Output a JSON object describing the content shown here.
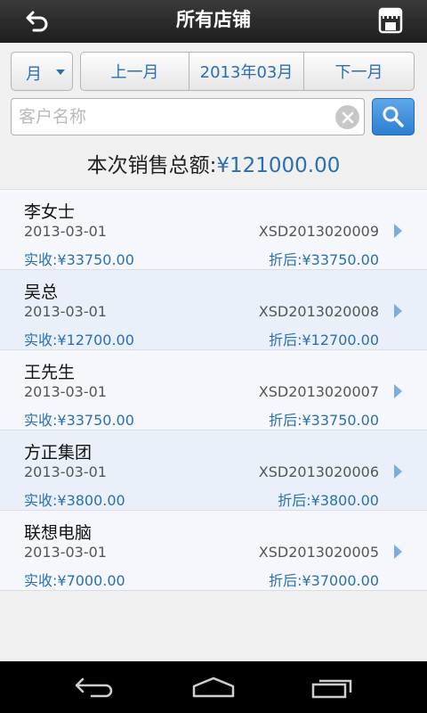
{
  "header": {
    "title": "所有店铺",
    "back_icon": "back-arrow-icon",
    "store_icon": "store-icon"
  },
  "filter": {
    "period_selected": "月",
    "prev_label": "上一月",
    "current_label": "2013年03月",
    "next_label": "下一月"
  },
  "search": {
    "placeholder": "客户名称",
    "value": ""
  },
  "summary": {
    "label": "本次销售总额:",
    "amount": "¥121000.00"
  },
  "orders": [
    {
      "customer": "李女士",
      "date": "2013-03-01",
      "code": "XSD2013020009",
      "paid": "实收:¥33750.00",
      "discounted": "折后:¥33750.00"
    },
    {
      "customer": "吴总",
      "date": "2013-03-01",
      "code": "XSD2013020008",
      "paid": "实收:¥12700.00",
      "discounted": "折后:¥12700.00"
    },
    {
      "customer": "王先生",
      "date": "2013-03-01",
      "code": "XSD2013020007",
      "paid": "实收:¥33750.00",
      "discounted": "折后:¥33750.00"
    },
    {
      "customer": "方正集团",
      "date": "2013-03-01",
      "code": "XSD2013020006",
      "paid": "实收:¥3800.00",
      "discounted": "折后:¥3800.00"
    },
    {
      "customer": "联想电脑",
      "date": "2013-03-01",
      "code": "XSD2013020005",
      "paid": "实收:¥7000.00",
      "discounted": "折后:¥37000.00"
    }
  ],
  "colors": {
    "accent": "#2a6fb0",
    "titlebar": "#2b2b2b",
    "search_button": "#3d8edb"
  }
}
